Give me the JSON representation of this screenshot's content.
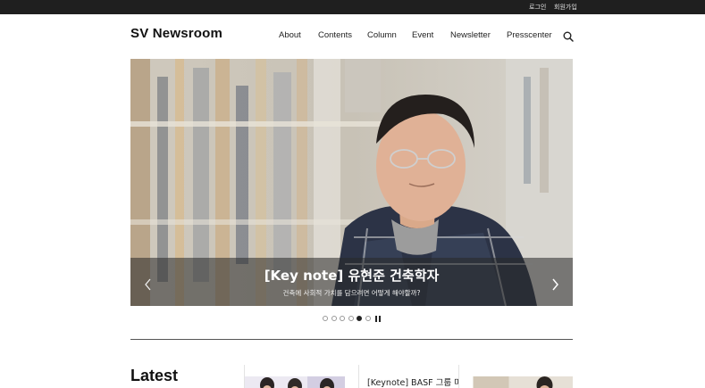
{
  "topbar": {
    "login": "로그인",
    "signup": "회원가입"
  },
  "header": {
    "logo": "SV Newsroom",
    "nav": [
      "About",
      "Contents",
      "Column",
      "Event",
      "Newsletter",
      "Presscenter"
    ]
  },
  "hero": {
    "title": "[Key note] 유현준 건축학자",
    "subtitle": "건축에 사회적 가치를 담으려면 어떻게 해야할까?",
    "slide_count": 6,
    "active_slide": 5
  },
  "latest": {
    "heading": "Latest",
    "cards": [
      {
        "title": ""
      },
      {
        "title": "[Keynote] BASF 그룹 마틴"
      },
      {
        "title": ""
      }
    ]
  },
  "colors": {
    "topbar": "#1f1f1f",
    "caption_overlay": "rgba(40,40,40,0.55)"
  }
}
